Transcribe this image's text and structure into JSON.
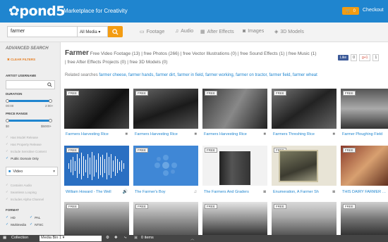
{
  "header": {
    "logo": "✿pond5",
    "tagline": "Marketplace for Creativity",
    "cart_count": "0",
    "checkout": "Checkout"
  },
  "search": {
    "value": "farmer",
    "media_select": "All Media",
    "tabs": [
      {
        "label": "Footage"
      },
      {
        "label": "Audio"
      },
      {
        "label": "After Effects"
      },
      {
        "label": "Images"
      },
      {
        "label": "3D Models"
      }
    ]
  },
  "sidebar": {
    "advanced_search": "ADVANCED SEARCH",
    "clear_filters": "✖ CLEAR FILTERS",
    "artist_label": "ARTIST USERNAME",
    "duration_label": "DURATION",
    "duration_min": "00:00",
    "duration_max": "2:00+",
    "price_label": "PRICE RANGE",
    "price_min": "$0",
    "price_max": "$5000+",
    "filters": [
      {
        "label": "Has Model Release",
        "on": false
      },
      {
        "label": "Has Property Release",
        "on": false
      },
      {
        "label": "Include Sensitive Content",
        "on": false
      },
      {
        "label": "Public Domain Only",
        "on": true
      }
    ],
    "video_label": "Video",
    "video_opts": [
      {
        "label": "Contains Audio"
      },
      {
        "label": "Seamless Looping"
      },
      {
        "label": "Includes Alpha Channel"
      }
    ],
    "format_label": "FORMAT",
    "formats": [
      {
        "label": "HD"
      },
      {
        "label": "PAL"
      },
      {
        "label": "Multimedia"
      },
      {
        "label": "NTSC"
      }
    ]
  },
  "results": {
    "query": "Farmer",
    "summary_line1": "Free Video Footage (13) | free Photos (266) | free Vector Illustrations (0) | free Sound Effects (1) | free Music (1)",
    "summary_line2": "| free After Effects Projects (0) | free 3D Models (0)",
    "share_fb": "Like",
    "share_fb_count": "0",
    "share_gp": "g+1",
    "share_gp_count": "1",
    "related_label": "Related searches",
    "related": "farmer cheese, farmer hands, farmer dirt, farmer in field, farmer working, farmer on tractor, farmer field, farmer wheat",
    "badge": "FREE",
    "rows": [
      [
        {
          "title": "Farmers Harvesting Rice",
          "icon": "video"
        },
        {
          "title": "Farmers Harvesting Rice",
          "icon": "video"
        },
        {
          "title": "Farmers Harvesting Rice",
          "icon": "video"
        },
        {
          "title": "Farmers Threshing Rice",
          "icon": "video"
        },
        {
          "title": "Farmer Ploughing Field",
          "icon": "video"
        }
      ],
      [
        {
          "title": "William Howard - The Well",
          "icon": "audio"
        },
        {
          "title": "The Farmer's Boy",
          "icon": "music"
        },
        {
          "title": "The Farmers And Graders",
          "icon": "photo"
        },
        {
          "title": "Enumeration, A Farmer Sh",
          "icon": "photo"
        },
        {
          "title": "THIS DAIRY FARMER Nee",
          "icon": "photo"
        }
      ],
      [
        {
          "title": "",
          "icon": ""
        },
        {
          "title": "",
          "icon": ""
        },
        {
          "title": "",
          "icon": ""
        },
        {
          "title": "",
          "icon": ""
        },
        {
          "title": "",
          "icon": ""
        }
      ]
    ]
  },
  "bottom_bar": {
    "collection": "Collection",
    "bin": "Media Bin 1",
    "items": "0 items"
  },
  "colors": {
    "brand": "#1f85cf",
    "accent": "#f39c12"
  }
}
